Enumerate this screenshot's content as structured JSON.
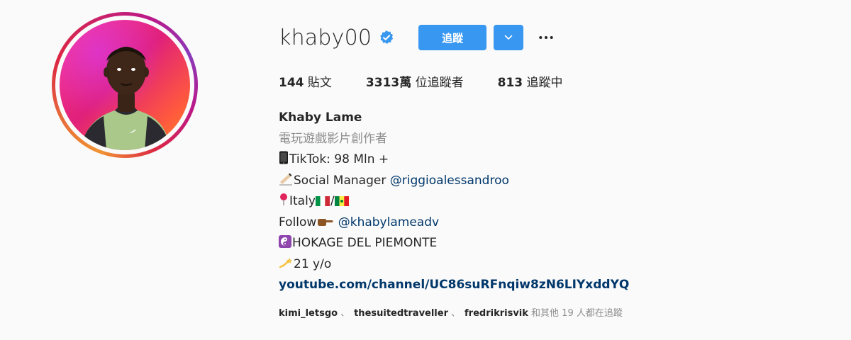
{
  "profile": {
    "username": "khaby00",
    "verified": true,
    "follow_label": "追蹤",
    "accent_color": "#3897f0",
    "avatar_icon": "profile-photo"
  },
  "stats": {
    "posts_count": "144",
    "posts_label": "貼文",
    "followers_count": "3313萬",
    "followers_label": "位追蹤者",
    "following_count": "813",
    "following_label": "追蹤中"
  },
  "bio": {
    "full_name": "Khaby Lame",
    "category": "電玩遊戲影片創作者",
    "line1_text": "TikTok: 98 Mln +",
    "line1_icon": "phone-icon",
    "line2_text": "Social Manager ",
    "line2_icon": "writing-hand-icon",
    "line2_mention": "@riggioalessandroo",
    "line3_text": "Italy",
    "line3_sep": "/",
    "line3_icons": [
      "pin-icon",
      "italy-flag-icon",
      "senegal-flag-icon"
    ],
    "line4_text": "Follow",
    "line4_icon": "pointing-hand-icon",
    "line4_mention": "@khabylameadv",
    "line5_text": "HOKAGE DEL PIEMONTE",
    "line5_icon": "yin-yang-icon",
    "line6_text": "21 y/o",
    "line6_icon": "dizzy-icon",
    "website": "youtube.com/channel/UC86suRFnqiw8zN6LIYxddYQ"
  },
  "followed_by": {
    "users": [
      "kimi_letsgo",
      "thesuitedtraveller",
      "fredrikrisvik"
    ],
    "separator": "、",
    "suffix": "和其他 19 人都在追蹤"
  }
}
